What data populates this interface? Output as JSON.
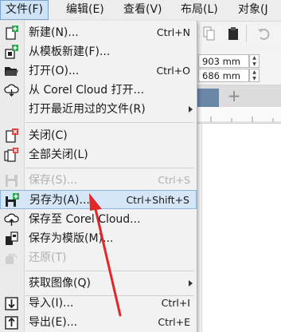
{
  "menubar": [
    {
      "label": "文件(F)",
      "active": true
    },
    {
      "label": "编辑(E)",
      "active": false
    },
    {
      "label": "查看(V)",
      "active": false
    },
    {
      "label": "布局(L)",
      "active": false
    },
    {
      "label": "对象(J",
      "active": false
    }
  ],
  "properties": {
    "width_value": "903 mm",
    "height_value": "686 mm"
  },
  "file_menu": {
    "new": {
      "label": "新建(N)...",
      "shortcut": "Ctrl+N"
    },
    "new_from_template": {
      "label": "从模板新建(F)..."
    },
    "open": {
      "label": "打开(O)...",
      "shortcut": "Ctrl+O"
    },
    "open_cloud": {
      "label": "从 Corel Cloud 打开..."
    },
    "open_recent": {
      "label": "打开最近用过的文件(R)"
    },
    "close": {
      "label": "关闭(C)"
    },
    "close_all": {
      "label": "全部关闭(L)"
    },
    "save": {
      "label": "保存(S)...",
      "shortcut": "Ctrl+S"
    },
    "save_as": {
      "label": "另存为(A)...",
      "shortcut": "Ctrl+Shift+S"
    },
    "save_to_cloud": {
      "label": "保存至 Corel Cloud..."
    },
    "save_as_template": {
      "label": "保存为模版(M)..."
    },
    "revert": {
      "label": "还原(T)"
    },
    "acquire_image": {
      "label": "获取图像(Q)"
    },
    "import": {
      "label": "导入(I)...",
      "shortcut": "Ctrl+I"
    },
    "export": {
      "label": "导出(E)...",
      "shortcut": "Ctrl+E"
    }
  },
  "colors": {
    "selection": "#d5e7f7",
    "annotation_arrow": "#e0282a",
    "icon_green": "#2fa84f"
  },
  "icons": [
    "new-doc-icon",
    "template-icon",
    "open-folder-icon",
    "cloud-download-icon",
    "close-doc-icon",
    "close-all-icon",
    "save-icon",
    "save-as-icon",
    "cloud-upload-icon",
    "template-save-icon",
    "revert-icon",
    "import-icon",
    "export-icon"
  ]
}
